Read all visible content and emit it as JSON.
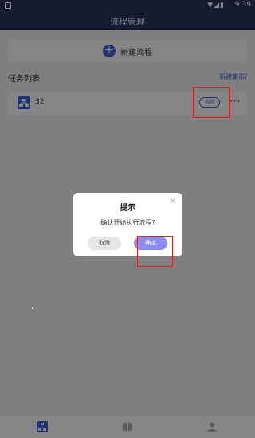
{
  "status_bar": {
    "time": "9:39",
    "signal": "▼◢▮"
  },
  "header": {
    "title": "流程管理"
  },
  "new_flow": {
    "plus": "+",
    "label": "新建流程"
  },
  "task_section": {
    "title": "任务列表",
    "link": "新建集市/"
  },
  "task_row": {
    "name": "32",
    "start_label": "启动",
    "more": "···"
  },
  "dialog": {
    "title": "提示",
    "close": "×",
    "message": "确认开始执行流程?",
    "cancel_label": "取消",
    "confirm_label": "确定"
  },
  "colors": {
    "primary": "#3e63d8",
    "header": "#28365c",
    "confirm": "#8b8df2",
    "highlight": "#e02020"
  },
  "icons": {
    "task": "flowchart-icon",
    "tab1": "flowchart-icon",
    "tab2": "book-icon",
    "tab3": "user-icon"
  }
}
